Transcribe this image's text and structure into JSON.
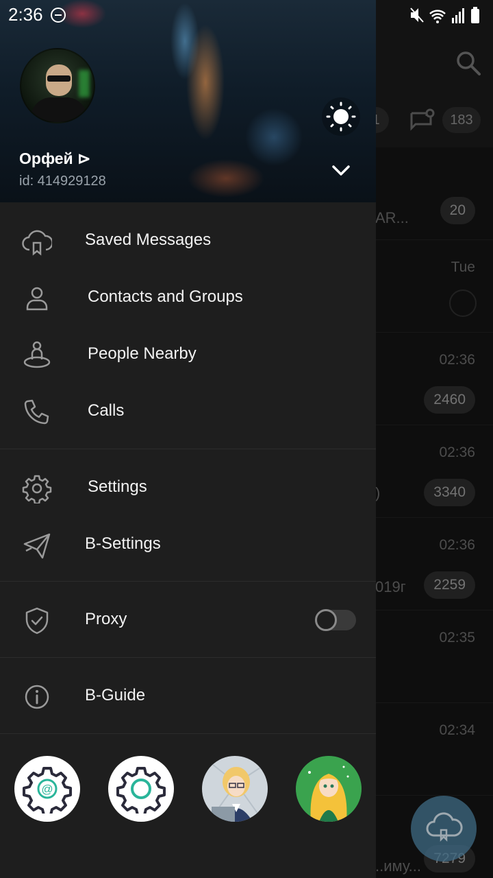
{
  "status_bar": {
    "time": "2:36"
  },
  "background": {
    "tab_counts": [
      "1",
      "183"
    ],
    "chats": [
      {
        "time": "",
        "badge": "20",
        "fragment": "AR..."
      },
      {
        "time": "Tue",
        "badge": "",
        "fragment": ""
      },
      {
        "time": "02:36",
        "badge": "2460",
        "fragment": ""
      },
      {
        "time": "02:36",
        "badge": "3340",
        "fragment": ")"
      },
      {
        "time": "02:36",
        "badge": "2259",
        "fragment": "019г"
      },
      {
        "time": "02:35",
        "badge": "",
        "fragment": ""
      },
      {
        "time": "02:34",
        "badge": "",
        "fragment": ""
      },
      {
        "time": "",
        "badge": "7279",
        "fragment": "..иму..."
      }
    ]
  },
  "drawer": {
    "user": {
      "name": "Орфей ⊳",
      "id": "id: 414929128"
    },
    "menu_sections": [
      [
        {
          "label": "Saved Messages",
          "icon": "cloud-bookmark-icon"
        },
        {
          "label": "Contacts and Groups",
          "icon": "person-icon"
        },
        {
          "label": "People Nearby",
          "icon": "people-nearby-icon"
        },
        {
          "label": "Calls",
          "icon": "phone-icon"
        }
      ],
      [
        {
          "label": "Settings",
          "icon": "gear-icon"
        },
        {
          "label": "B-Settings",
          "icon": "paper-plane-icon"
        }
      ],
      [
        {
          "label": "Proxy",
          "icon": "shield-icon",
          "toggle": false
        }
      ],
      [
        {
          "label": "B-Guide",
          "icon": "info-icon"
        }
      ]
    ],
    "accounts": [
      "gear-at-icon",
      "gear-circle-icon",
      "anime-avatar-1",
      "anime-avatar-2"
    ]
  },
  "colors": {
    "accent": "#3f6a84",
    "drawer_bg": "#1e1e1e",
    "teal": "#2ab59a"
  }
}
